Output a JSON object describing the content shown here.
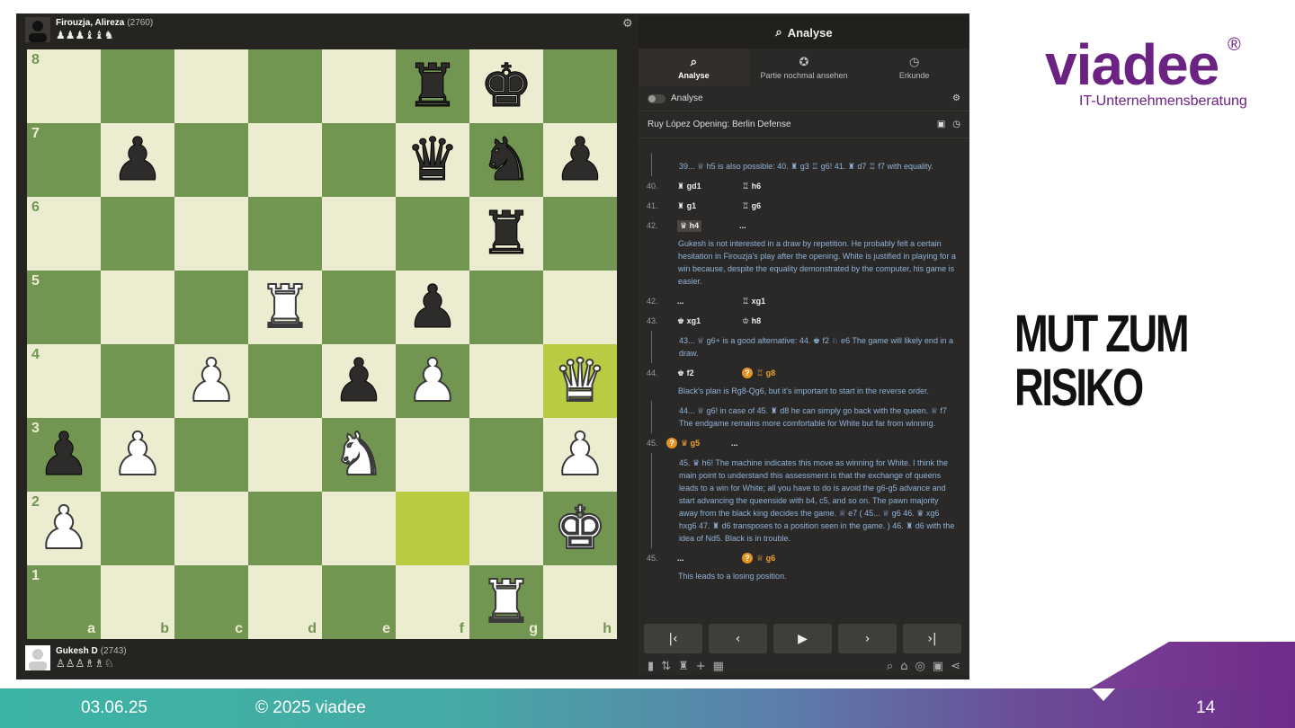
{
  "screenshot": {
    "top_player": {
      "name": "Firouzja, Alireza",
      "rating": "(2760)",
      "captured": "♟♟♟♝♝♞"
    },
    "bottom_player": {
      "name": "Gukesh D",
      "rating": "(2743)",
      "captured": "♙♙♙♗♗♘"
    },
    "board": {
      "ranks": [
        "8",
        "7",
        "6",
        "5",
        "4",
        "3",
        "2",
        "1"
      ],
      "files": [
        "a",
        "b",
        "c",
        "d",
        "e",
        "f",
        "g",
        "h"
      ],
      "highlighted": [
        "h4",
        "f2"
      ],
      "pieces": {
        "f8": "bR",
        "g8": "bK",
        "b7": "bP",
        "f7": "bQ",
        "g7": "bN",
        "h7": "bP",
        "g6": "bR",
        "d5": "wR",
        "f5": "bP",
        "c4": "wP",
        "e4": "bP",
        "f4": "wP",
        "h4": "wQ",
        "a3": "bP",
        "b3": "wP",
        "e3": "wN",
        "h3": "wP",
        "a2": "wP",
        "h2": "wK",
        "g1": "wR"
      }
    },
    "source": "Quelle: chess.com",
    "panel": {
      "title": "Analyse",
      "tabs": [
        {
          "label": "Analyse",
          "icon": "magnifier-icon"
        },
        {
          "label": "Partie nochmal ansehen",
          "icon": "replay-icon"
        },
        {
          "label": "Erkunde",
          "icon": "compass-icon"
        }
      ],
      "toggle_label": "Analyse",
      "opening": "Ruy López Opening: Berlin Defense",
      "moves": {
        "var1": "39... ♕ h5  is also possible:  40. ♜ g3  ♖ g6!  41. ♜ d7  ♖ f7  with equality.",
        "m40": {
          "num": "40.",
          "w": "♜ gd1",
          "b": "♖ h6"
        },
        "m41": {
          "num": "41.",
          "w": "♜ g1",
          "b": "♖ g6"
        },
        "m42": {
          "num": "42.",
          "w": "♛ h4",
          "b": "..."
        },
        "note42": "Gukesh is not interested in a draw by repetition. He probably felt a certain hesitation in Firouzja's play after the opening. White is justified in playing for a win because, despite the equality demonstrated by the computer, his game is easier.",
        "m42b": {
          "num": "42.",
          "w": "...",
          "b": "♖ xg1"
        },
        "m43": {
          "num": "43.",
          "w": "♚ xg1",
          "b": "♔ h8"
        },
        "var43": "43... ♕ g6+  is a good alternative:  44. ♚ f2  ♘ e6  The game will likely end in a draw.",
        "m44": {
          "num": "44.",
          "w": "♚ f2",
          "b": "♖ g8"
        },
        "note44": "Black's plan is Rg8-Qg6, but it's important to start in the reverse order.",
        "var44": "44... ♕ g6!  in case of  45. ♜ d8  he can simply go back with the queen.  ♕ f7  The endgame remains more comfortable for White but far from winning.",
        "m45": {
          "num": "45.",
          "w": "♛ g5",
          "b": "..."
        },
        "var45": "45. ♛ h6!  The machine indicates this move as winning for White. I think the main point to understand this assessment is that the exchange of queens leads to a win for White; all you have to do is avoid the g6-g5 advance and start advancing the queenside with b4, c5, and so on. The pawn majority away from the black king decides the game.  ♕ e7  ( 45... ♕ g6  46. ♛ xg6  hxg6  47. ♜ d6  transposes to a position seen in the game. )  46. ♜ d6  with the idea of Nd5. Black is in trouble.",
        "m45b": {
          "num": "45.",
          "w": "...",
          "b": "♕ g6"
        },
        "note45b": "This leads to a losing position."
      },
      "nav": [
        "first-move-button",
        "prev-move-button",
        "play-button",
        "next-move-button",
        "last-move-button"
      ]
    }
  },
  "logo": {
    "word": "viadee",
    "reg": "®",
    "sub": "IT-Unternehmensberatung"
  },
  "heading": {
    "line1": "MUT ZUM",
    "line2": "RISIKO"
  },
  "footer": {
    "date": "03.06.25",
    "copyright": "© 2025 viadee",
    "page": "14"
  },
  "colors": {
    "brand": "#6b2283",
    "board_light": "#ebecd0",
    "board_dark": "#739552",
    "highlight": "#b9ca43"
  }
}
